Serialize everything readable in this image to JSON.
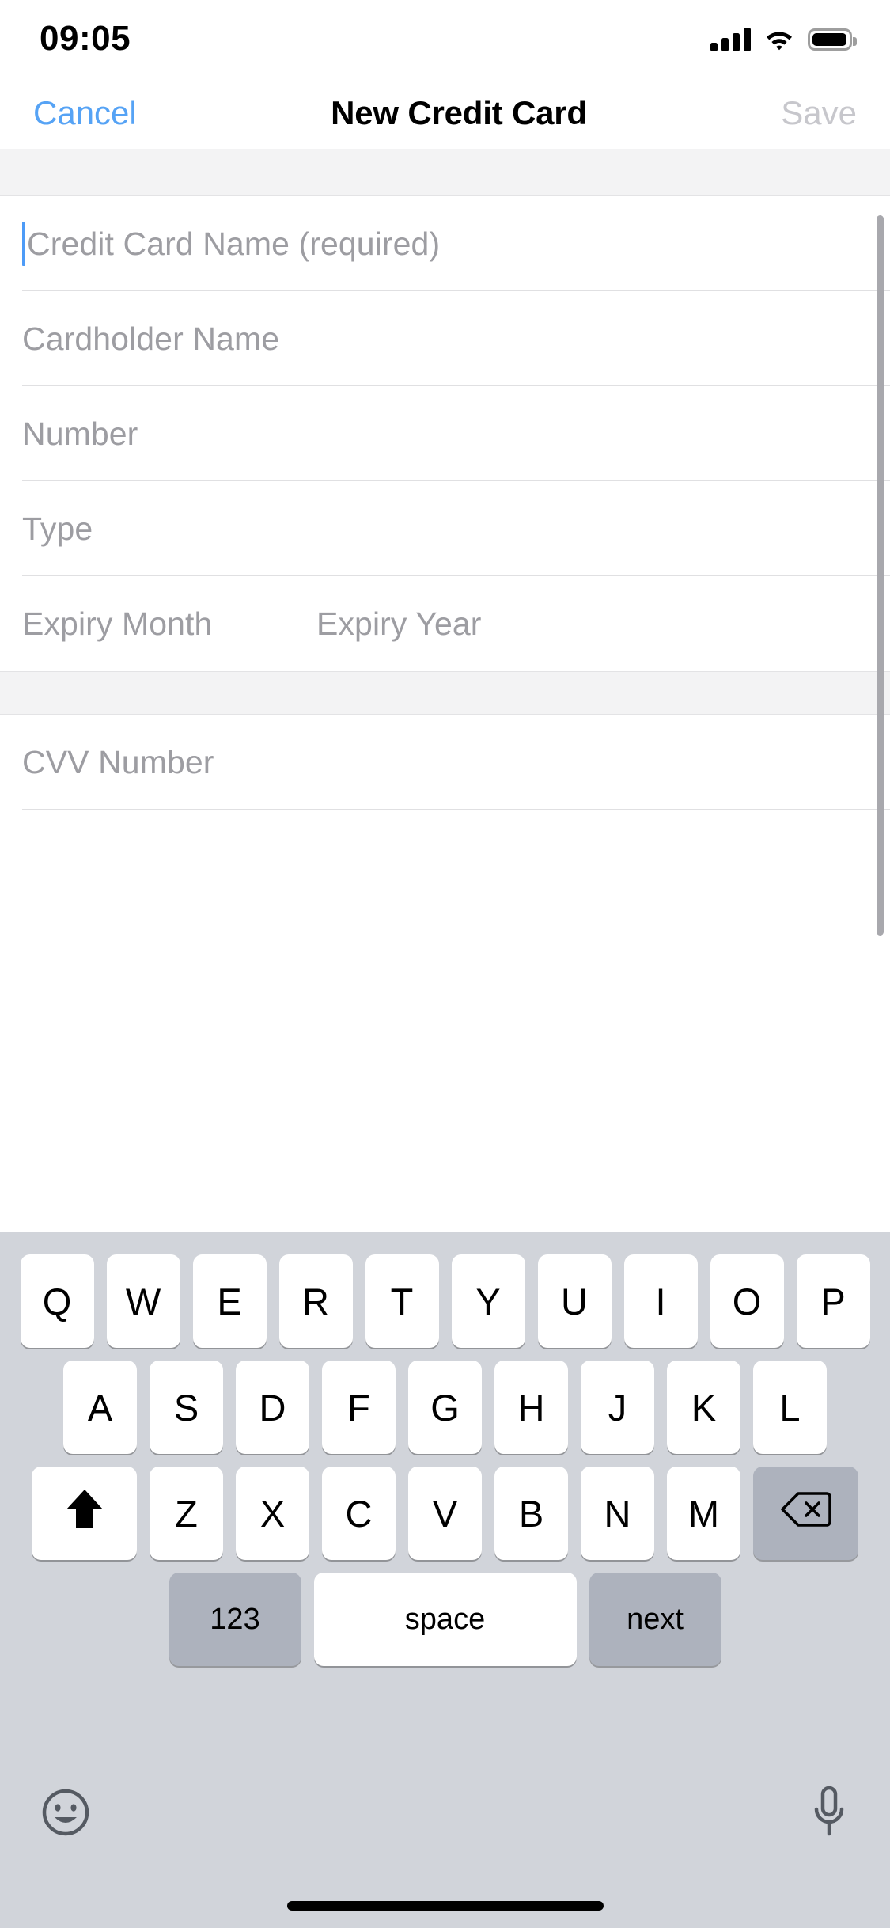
{
  "status_bar": {
    "time": "09:05",
    "signal_icon": "cellular-signal-icon",
    "wifi_icon": "wifi-icon",
    "battery_icon": "battery-icon",
    "battery_level": "85"
  },
  "nav_bar": {
    "cancel_label": "Cancel",
    "title": "New Credit Card",
    "save_label": "Save",
    "cancel_color": "#56a3f5",
    "save_color": "#c7c7cc",
    "save_enabled": "false"
  },
  "form": {
    "section_one": [
      {
        "placeholder": "Credit Card Name (required)",
        "value": "",
        "focused": "true"
      },
      {
        "placeholder": "Cardholder Name",
        "value": "",
        "focused": "false"
      },
      {
        "placeholder": "Number",
        "value": "",
        "focused": "false"
      },
      {
        "placeholder": "Type",
        "value": "",
        "focused": "false"
      }
    ],
    "expiry_row": {
      "month_placeholder": "Expiry Month",
      "month_value": "",
      "year_placeholder": "Expiry Year",
      "year_value": ""
    },
    "section_two": [
      {
        "placeholder": "CVV Number",
        "value": "",
        "focused": "false"
      }
    ]
  },
  "keyboard": {
    "row1": [
      "Q",
      "W",
      "E",
      "R",
      "T",
      "Y",
      "U",
      "I",
      "O",
      "P"
    ],
    "row2": [
      "A",
      "S",
      "D",
      "F",
      "G",
      "H",
      "J",
      "K",
      "L"
    ],
    "row3": [
      "Z",
      "X",
      "C",
      "V",
      "B",
      "N",
      "M"
    ],
    "shift_icon": "shift-up-arrow-icon",
    "backspace_icon": "backspace-delete-icon",
    "numbers_label": "123",
    "space_label": "space",
    "return_label": "next",
    "emoji_icon": "emoji-smiley-icon",
    "mic_icon": "microphone-icon",
    "background_color": "#d1d4da",
    "key_color": "#ffffff",
    "modifier_key_color": "#adb2bd"
  },
  "home_indicator": "home-indicator"
}
